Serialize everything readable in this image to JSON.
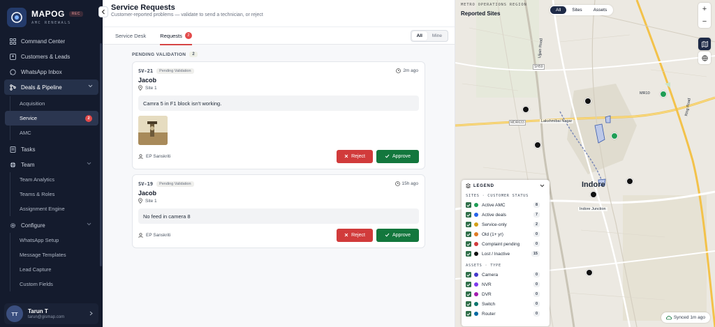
{
  "brand": {
    "name": "MAPOG",
    "tag": "REC",
    "subtitle": "AMC RENEWALS"
  },
  "sidebar": {
    "items": [
      {
        "label": "Command Center",
        "icon": "grid-icon"
      },
      {
        "label": "Customers & Leads",
        "icon": "users-icon"
      },
      {
        "label": "WhatsApp Inbox",
        "icon": "whatsapp-icon"
      },
      {
        "label": "Deals & Pipeline",
        "icon": "pipeline-icon"
      }
    ],
    "deals_sub": [
      {
        "label": "Acquisition"
      },
      {
        "label": "Service",
        "badge": "2"
      },
      {
        "label": "AMC"
      }
    ],
    "tasks": "Tasks",
    "team": "Team",
    "team_sub": [
      "Team Analytics",
      "Teams & Roles",
      "Assignment Engine"
    ],
    "configure": "Configure",
    "configure_sub": [
      "WhatsApp Setup",
      "Message Templates",
      "Lead Capture",
      "Custom Fields"
    ],
    "user": {
      "initials": "TT",
      "name": "Tarun T",
      "email": "tarun@gismap.com"
    }
  },
  "header": {
    "title": "Service Requests",
    "subtitle": "Customer-reported problems — validate to send a technician, or reject"
  },
  "tabs": [
    {
      "label": "Service Desk"
    },
    {
      "label": "Requests",
      "badge": "2"
    }
  ],
  "filter": {
    "options": [
      "All",
      "Mine"
    ],
    "selected": "All"
  },
  "section": {
    "label": "PENDING VALIDATION",
    "count": "2"
  },
  "requests": [
    {
      "id": "SV-21",
      "status": "Pending Validation",
      "time": "2m ago",
      "customer": "Jacob",
      "site": "Site 1",
      "message": "Camra 5 in F1 block isn't working.",
      "technician": "EP Sanskriti",
      "reject": "Reject",
      "approve": "Approve"
    },
    {
      "id": "SV-19",
      "status": "Pending Validation",
      "time": "15h ago",
      "customer": "Jacob",
      "site": "Site 1",
      "message": "No feed in camera 8",
      "technician": "EP Sanskriti",
      "reject": "Reject",
      "approve": "Approve"
    }
  ],
  "map": {
    "overline": "METRO OPERATIONS REGION",
    "title": "Reported Sites",
    "toggle": [
      "All",
      "Sites",
      "Assets"
    ],
    "toggle_selected": "All",
    "city": "Indore",
    "places": [
      "Lakshmibai Nagar",
      "Indore Junction",
      "Ring Road",
      "Ujjain Road",
      "MR10"
    ],
    "road_markers": [
      "SH59",
      "MDR633"
    ],
    "synced": "Synced 1m ago"
  },
  "legend": {
    "title": "LEGEND",
    "sites_header": "SITES · CUSTOMER STATUS",
    "sites": [
      {
        "label": "Active AMC",
        "count": "8",
        "color": "#1f9d55"
      },
      {
        "label": "Active deals",
        "count": "7",
        "color": "#2563eb"
      },
      {
        "label": "Service-only",
        "count": "2",
        "color": "#d4a017"
      },
      {
        "label": "Old (1+ yr)",
        "count": "0",
        "color": "#e07b24"
      },
      {
        "label": "Complaint pending",
        "count": "0",
        "color": "#d13b3b"
      },
      {
        "label": "Lost / Inactive",
        "count": "15",
        "color": "#111111"
      }
    ],
    "assets_header": "ASSETS · TYPE",
    "assets": [
      {
        "label": "Camera",
        "count": "0",
        "color": "#4338ca"
      },
      {
        "label": "NVR",
        "count": "0",
        "color": "#7c3aed"
      },
      {
        "label": "DVR",
        "count": "0",
        "color": "#a21caf"
      },
      {
        "label": "Switch",
        "count": "0",
        "color": "#0f766e"
      },
      {
        "label": "Router",
        "count": "0",
        "color": "#0369a1"
      }
    ]
  }
}
